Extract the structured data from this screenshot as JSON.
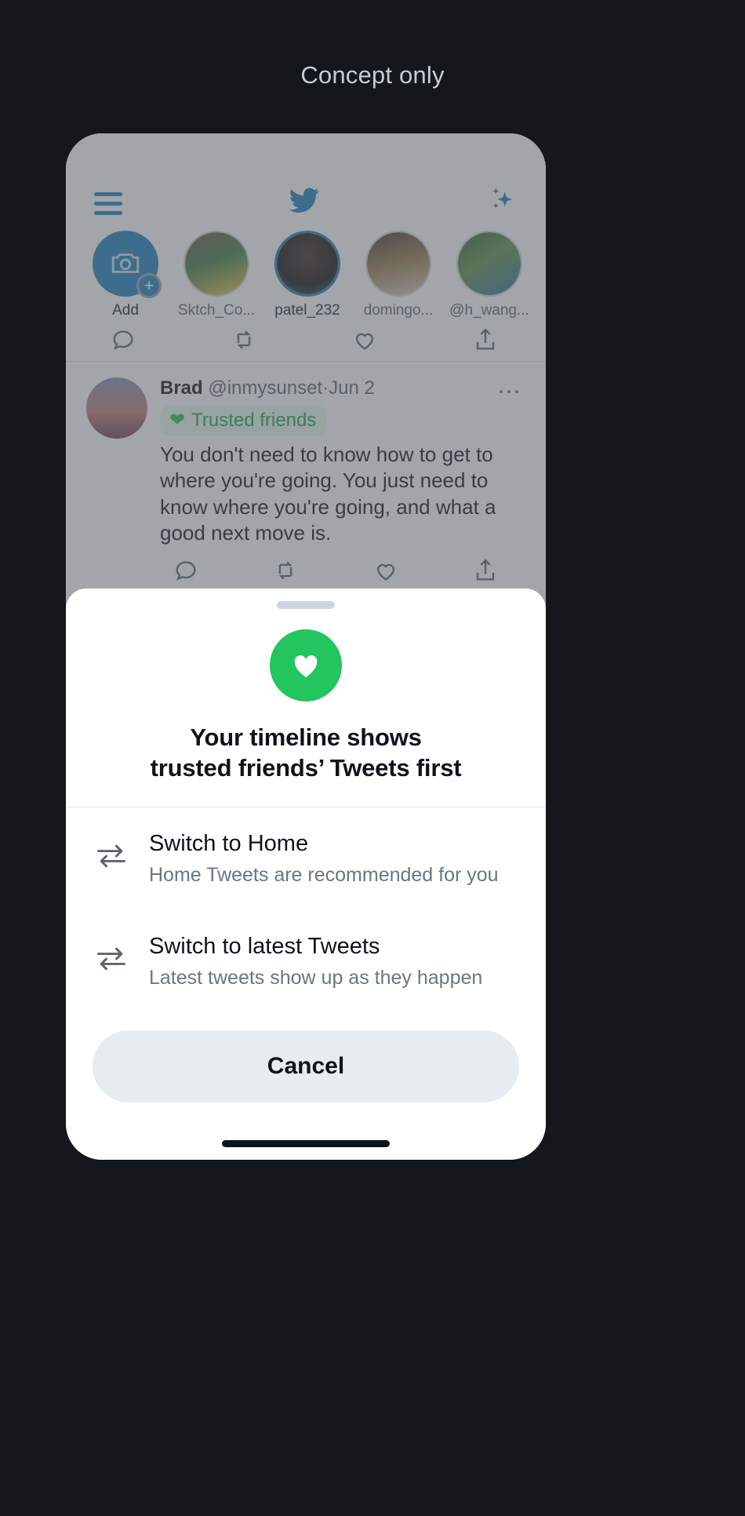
{
  "page": {
    "caption": "Concept only",
    "background_color": "#14181d",
    "caption_color": "#c4cdd6"
  },
  "app_header": {
    "menu_icon": "hamburger-menu-icon",
    "logo_icon": "twitter-bird-icon",
    "sparkle_icon": "sparkle-icon",
    "accent_color": "#1d7ebd"
  },
  "stories": {
    "items": [
      {
        "label": "Add",
        "type": "add",
        "icon": "camera-icon",
        "active": false
      },
      {
        "label": "Sktch_Co...",
        "type": "avatar",
        "active": false
      },
      {
        "label": "patel_232",
        "type": "avatar",
        "active": true
      },
      {
        "label": "domingo...",
        "type": "avatar",
        "active": false
      },
      {
        "label": "@h_wang...",
        "type": "avatar",
        "active": false
      }
    ]
  },
  "timeline": {
    "tweet": {
      "name": "Brad",
      "handle": "@inmysunset",
      "separator": "·",
      "date": "Jun 2",
      "badge": {
        "label": "Trusted friends",
        "icon": "heart-icon",
        "text_color": "#1e9e52",
        "background_color": "#eafbf0"
      },
      "text": "You don't need to know how to get to where you're going. You just need to know where you're going, and what a good next move is.",
      "actions": [
        {
          "icon": "reply-icon"
        },
        {
          "icon": "retweet-icon"
        },
        {
          "icon": "like-icon"
        },
        {
          "icon": "share-icon"
        }
      ],
      "more_icon": "more-options-icon"
    },
    "clipped_tweet_above": {
      "actions": [
        {
          "icon": "reply-icon"
        },
        {
          "icon": "retweet-icon"
        },
        {
          "icon": "like-icon"
        },
        {
          "icon": "share-icon"
        }
      ]
    },
    "clipped_tweet_below": {
      "more_icon": "more-options-icon"
    }
  },
  "sheet": {
    "grabber": "drag-handle",
    "icon": "heart-icon",
    "icon_background_color": "#22c55e",
    "title_line1": "Your timeline shows",
    "title_line2": "trusted friends’ Tweets first",
    "options": [
      {
        "icon": "swap-arrows-icon",
        "title": "Switch to Home",
        "description": "Home Tweets are recommended for you"
      },
      {
        "icon": "swap-arrows-icon",
        "title": "Switch to latest Tweets",
        "description": "Latest tweets show up as they happen"
      }
    ],
    "cancel_label": "Cancel"
  }
}
